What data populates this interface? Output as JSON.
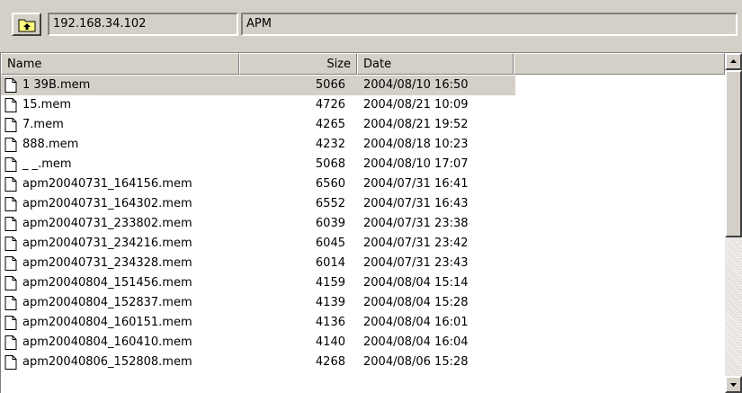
{
  "toolbar": {
    "up_icon": "folder-up-icon",
    "host": "192.168.34.102",
    "path": "APM"
  },
  "columns": {
    "name": "Name",
    "size": "Size",
    "date": "Date"
  },
  "files": [
    {
      "name": "1  39B.mem",
      "size": "5066",
      "date": "2004/08/10 16:50",
      "selected": true
    },
    {
      "name": "15.mem",
      "size": "4726",
      "date": "2004/08/21 10:09"
    },
    {
      "name": "7.mem",
      "size": "4265",
      "date": "2004/08/21 19:52"
    },
    {
      "name": "888.mem",
      "size": "4232",
      "date": "2004/08/18 10:23"
    },
    {
      "name": "_ _.mem",
      "size": "5068",
      "date": "2004/08/10 17:07"
    },
    {
      "name": "apm20040731_164156.mem",
      "size": "6560",
      "date": "2004/07/31 16:41"
    },
    {
      "name": "apm20040731_164302.mem",
      "size": "6552",
      "date": "2004/07/31 16:43"
    },
    {
      "name": "apm20040731_233802.mem",
      "size": "6039",
      "date": "2004/07/31 23:38"
    },
    {
      "name": "apm20040731_234216.mem",
      "size": "6045",
      "date": "2004/07/31 23:42"
    },
    {
      "name": "apm20040731_234328.mem",
      "size": "6014",
      "date": "2004/07/31 23:43"
    },
    {
      "name": "apm20040804_151456.mem",
      "size": "4159",
      "date": "2004/08/04 15:14"
    },
    {
      "name": "apm20040804_152837.mem",
      "size": "4139",
      "date": "2004/08/04 15:28"
    },
    {
      "name": "apm20040804_160151.mem",
      "size": "4136",
      "date": "2004/08/04 16:01"
    },
    {
      "name": "apm20040804_160410.mem",
      "size": "4140",
      "date": "2004/08/04 16:04"
    },
    {
      "name": "apm20040806_152808.mem",
      "size": "4268",
      "date": "2004/08/06 15:28"
    }
  ],
  "icons": {
    "file": "file-icon",
    "scroll_up": "scroll-up-arrow-icon",
    "scroll_down": "scroll-down-arrow-icon"
  }
}
